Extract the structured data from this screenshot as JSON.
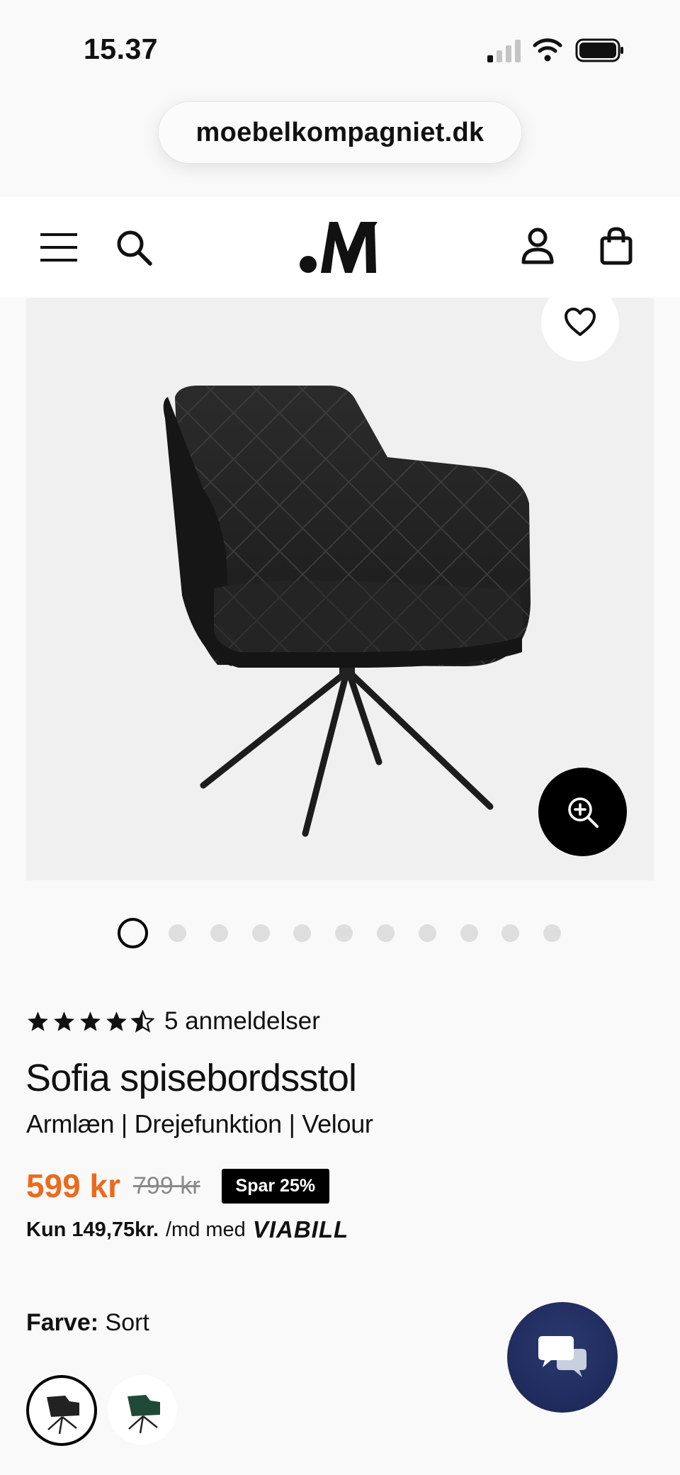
{
  "status_bar": {
    "time": "15.37"
  },
  "browser": {
    "url": "moebelkompagniet.dk"
  },
  "header": {
    "menu_icon": "hamburger-menu-icon",
    "search_icon": "search-icon",
    "logo_icon": "moebelkompagniet-logo",
    "account_icon": "user-icon",
    "cart_icon": "shopping-bag-icon"
  },
  "gallery": {
    "image_count": 11,
    "active_index": 0,
    "wishlist_icon": "heart-icon",
    "zoom_icon": "zoom-in-icon"
  },
  "product": {
    "rating": 4.5,
    "rating_max": 5,
    "reviews": "5 anmeldelser",
    "title": "Sofia spisebordsstol",
    "subtitle": "Armlæn | Drejefunktion | Velour",
    "price": "599 kr",
    "old_price": "799 kr",
    "save_badge": "Spar 25%",
    "installment_amount": "Kun 149,75kr.",
    "installment_text": "/md med",
    "installment_provider": "VIABILL",
    "color_label": "Farve:",
    "color_value": "Sort"
  },
  "colors": {
    "price_accent": "#ec6a1b",
    "chat_button": "#1f2a5c"
  },
  "chat": {
    "icon": "chat-bubbles-icon"
  }
}
